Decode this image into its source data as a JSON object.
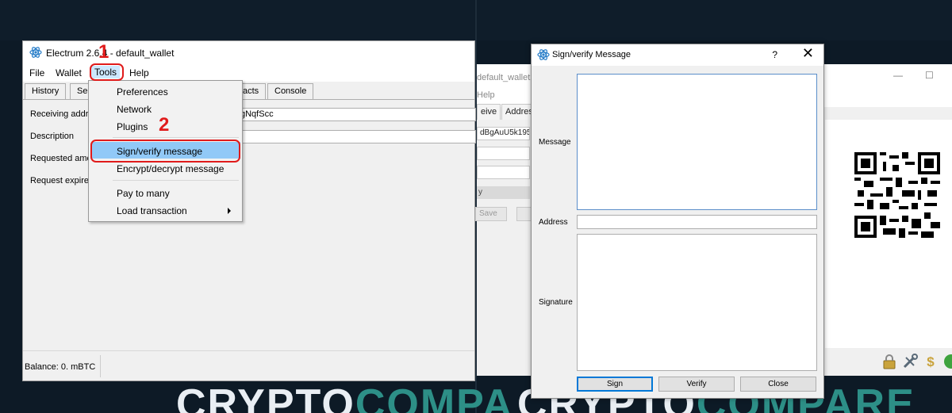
{
  "colors": {
    "annotation_red": "#e01b1b",
    "highlight_blue": "#91c9f7",
    "watermark_teal": "#2d8f87"
  },
  "watermark": {
    "left": {
      "part_a": "CRYPTO",
      "part_b": "COMPA"
    },
    "right": {
      "part_a": "CRYPTO",
      "part_b": "COMPARE"
    }
  },
  "main_window": {
    "title_app": "Electrum 2.6.4",
    "title_sep": " -  ",
    "title_wallet": "default_wallet",
    "icon": "electrum-atom-icon",
    "menu": {
      "file": "File",
      "wallet": "Wallet",
      "tools": "Tools",
      "help": "Help"
    },
    "tabs": {
      "history": "History",
      "send": "Ser",
      "contacts": "acts",
      "console": "Console"
    },
    "form": {
      "receiving_address_label": "Receiving addre",
      "receiving_address_value": "gNqfScc",
      "description_label": "Description",
      "requested_amount_label": "Requested amo",
      "request_expires_label": "Request expire"
    },
    "status": {
      "balance": "Balance: 0. mBTC"
    }
  },
  "tools_menu": {
    "items": {
      "preferences": "Preferences",
      "network": "Network",
      "plugins": "Plugins",
      "sign_verify": "Sign/verify message",
      "encrypt_decrypt": "Encrypt/decrypt message",
      "pay_to_many": "Pay to many",
      "load_transaction": "Load transaction"
    }
  },
  "annotations": {
    "step1": "1",
    "step2": "2"
  },
  "background_window": {
    "title_fragment": "default_wallet",
    "menu_fragment": "Help",
    "tab_receive": "eive",
    "tab_addresses": "Addres",
    "address_fragment": "dBgAuU5k195w",
    "strip_text": "y",
    "save_label": "Save"
  },
  "dialog": {
    "title": "Sign/verify Message",
    "help_glyph": "?",
    "close_glyph": "✕",
    "message_label": "Message",
    "address_label": "Address",
    "signature_label": "Signature",
    "message_value": "",
    "address_value": "",
    "signature_value": "",
    "sign_button": "Sign",
    "verify_button": "Verify",
    "close_button": "Close"
  }
}
